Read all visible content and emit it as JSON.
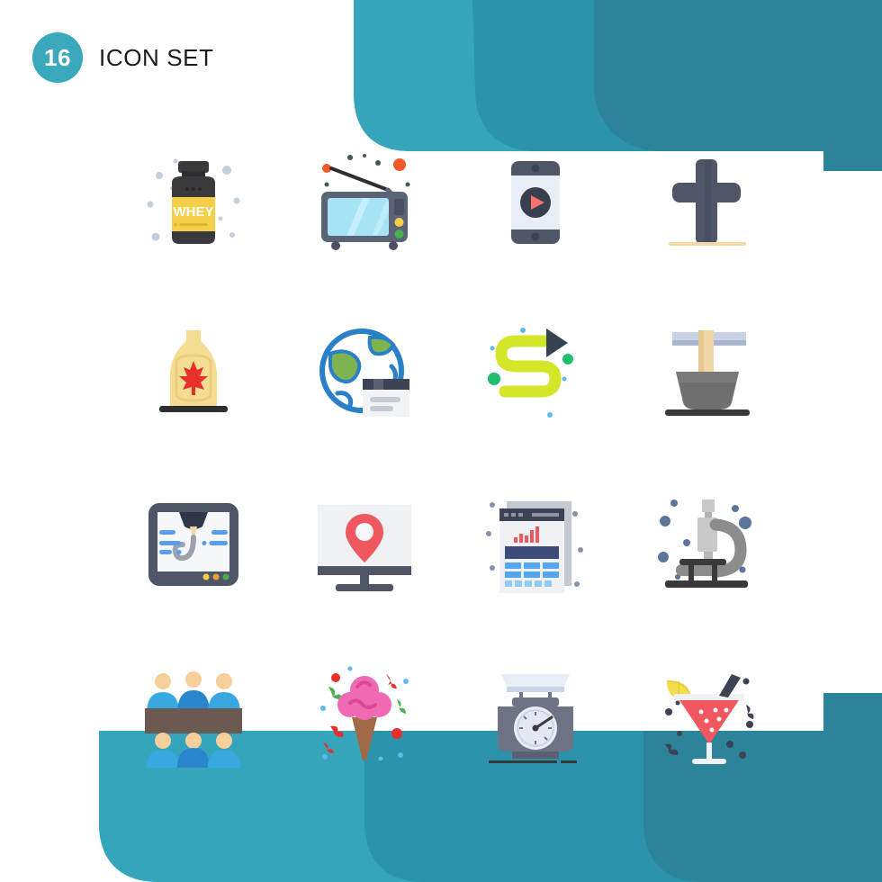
{
  "header": {
    "badge_count": "16",
    "title": "Icon Set",
    "badge_color": "#3ba9bd",
    "title_color": "#1d1d1d"
  },
  "theme": {
    "background": "#ffffff",
    "banner_light": "#35a5bb",
    "banner_mid": "#2b93ab",
    "banner_dark": "#2b8499"
  },
  "grid": {
    "columns": 4,
    "rows": 4,
    "total_icons": 16
  },
  "icons": [
    {
      "id": 1,
      "name": "whey-protein-bottle-icon",
      "label": "Whey Protein",
      "row": 1,
      "col": 1,
      "colors": [
        "#3a3a3c",
        "#f4cf47",
        "#ffffff"
      ]
    },
    {
      "id": 2,
      "name": "retro-television-icon",
      "label": "Television",
      "row": 1,
      "col": 2,
      "colors": [
        "#5b6377",
        "#a6e3f5",
        "#f05a28",
        "#f4cf47",
        "#4caf50"
      ]
    },
    {
      "id": 3,
      "name": "mobile-video-player-icon",
      "label": "Mobile Video",
      "row": 1,
      "col": 3,
      "colors": [
        "#4e5668",
        "#e9edf5",
        "#38404f",
        "#f4746a"
      ]
    },
    {
      "id": 4,
      "name": "christian-cross-icon",
      "label": "Cross",
      "row": 1,
      "col": 4,
      "colors": [
        "#4e5668",
        "#f5d9a8"
      ]
    },
    {
      "id": 5,
      "name": "maple-syrup-bottle-icon",
      "label": "Maple Syrup",
      "row": 2,
      "col": 1,
      "colors": [
        "#f4dd93",
        "#e8cd7c",
        "#e8302a",
        "#2e2e2e"
      ]
    },
    {
      "id": 6,
      "name": "global-browser-icon",
      "label": "Global Web",
      "row": 2,
      "col": 2,
      "colors": [
        "#2a7fc9",
        "#7fb350",
        "#f2f3f5",
        "#3d4354"
      ]
    },
    {
      "id": 7,
      "name": "route-path-arrow-icon",
      "label": "Route",
      "row": 2,
      "col": 3,
      "colors": [
        "#d4e62a",
        "#35424f",
        "#1fbf6e",
        "#62b8e8"
      ]
    },
    {
      "id": 8,
      "name": "mortar-pestle-icon",
      "label": "Mortar",
      "row": 2,
      "col": 4,
      "colors": [
        "#6f6f6f",
        "#f0d7a8",
        "#c9d3e8",
        "#3a3a3c"
      ]
    },
    {
      "id": 9,
      "name": "3d-printer-icon",
      "label": "3D Printer",
      "row": 3,
      "col": 1,
      "colors": [
        "#4e5668",
        "#f5f7fa",
        "#5a9ded",
        "#9aa3ad",
        "#2f3648"
      ]
    },
    {
      "id": 10,
      "name": "map-location-monitor-icon",
      "label": "Map Monitor",
      "row": 3,
      "col": 2,
      "colors": [
        "#eff1f4",
        "#f0575f",
        "#4e5668"
      ]
    },
    {
      "id": 11,
      "name": "analytics-report-icon",
      "label": "Report",
      "row": 3,
      "col": 3,
      "colors": [
        "#eff1f4",
        "#3d4b7a",
        "#f0575f",
        "#55a8f0",
        "#c5cad2"
      ]
    },
    {
      "id": 12,
      "name": "microscope-icon",
      "label": "Microscope",
      "row": 3,
      "col": 4,
      "colors": [
        "#8c8c8c",
        "#c9c9c9",
        "#3a3a3c",
        "#5d759b"
      ]
    },
    {
      "id": 13,
      "name": "audience-seating-icon",
      "label": "Audience",
      "row": 4,
      "col": 1,
      "colors": [
        "#37a9e0",
        "#2a86cc",
        "#f7cf9b",
        "#6b5a52"
      ]
    },
    {
      "id": 14,
      "name": "ice-cream-cone-icon",
      "label": "Ice Cream",
      "row": 4,
      "col": 2,
      "colors": [
        "#f06ab3",
        "#a06a46",
        "#e8302a",
        "#4caf50",
        "#62b8e8"
      ]
    },
    {
      "id": 15,
      "name": "kitchen-weight-scale-icon",
      "label": "Scale",
      "row": 4,
      "col": 3,
      "colors": [
        "#6f7386",
        "#c9d3e8",
        "#e9edf5",
        "#3a3a3c"
      ]
    },
    {
      "id": 16,
      "name": "cocktail-drink-icon",
      "label": "Cocktail",
      "row": 4,
      "col": 4,
      "colors": [
        "#f0575f",
        "#f4dd4a",
        "#3d4354",
        "#eff1f4"
      ]
    }
  ]
}
